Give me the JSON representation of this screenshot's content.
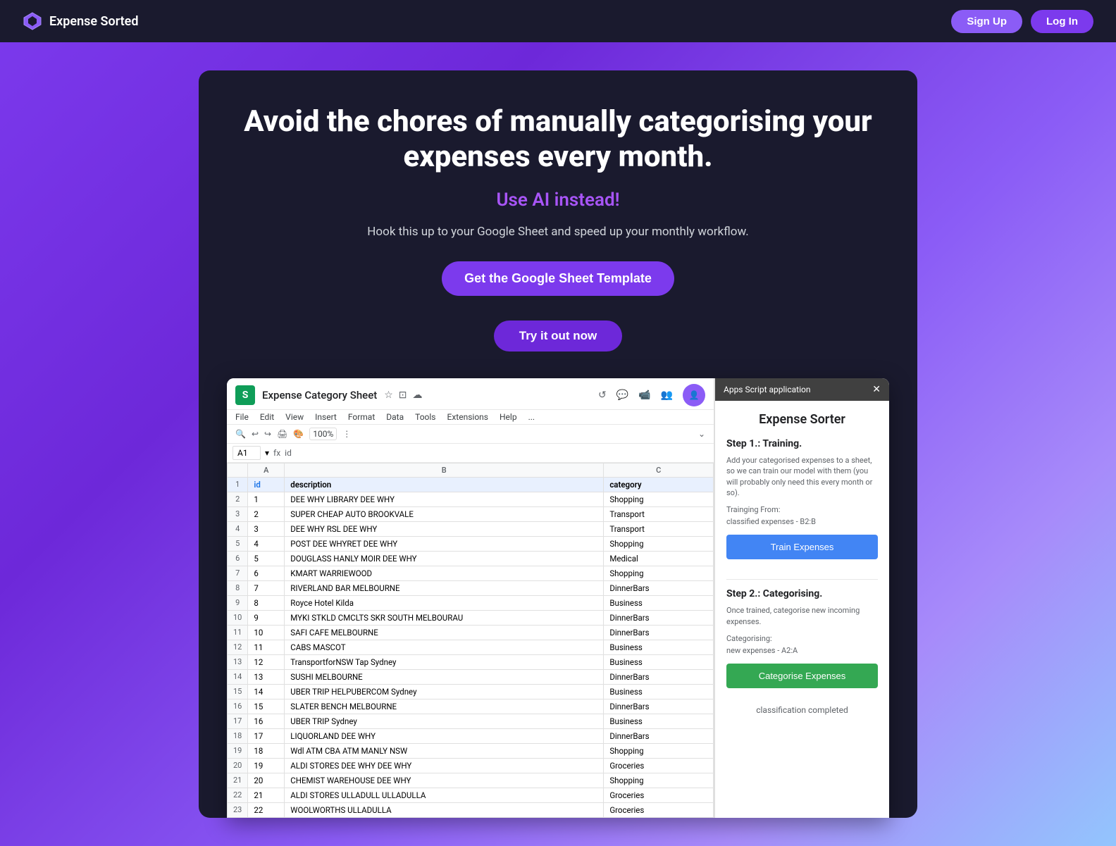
{
  "nav": {
    "brand": "Expense Sorted",
    "signup_label": "Sign Up",
    "login_label": "Log In"
  },
  "hero": {
    "headline": "Avoid the chores of manually categorising your expenses every month.",
    "subheadline": "Use AI instead!",
    "description": "Hook this up to your Google Sheet and speed up your monthly workflow.",
    "btn_google_sheet": "Get the Google Sheet Template",
    "btn_try": "Try it out now"
  },
  "spreadsheet": {
    "title": "Expense Category Sheet",
    "cell_ref": "A1",
    "cell_formula": "id",
    "menu_items": [
      "File",
      "Edit",
      "View",
      "Insert",
      "Format",
      "Data",
      "Tools",
      "Extensions",
      "Help",
      "..."
    ],
    "zoom": "100%",
    "columns": [
      "",
      "A",
      "B",
      "C"
    ],
    "header": [
      "",
      "id",
      "description",
      "category"
    ],
    "rows": [
      [
        "2",
        "1",
        "DEE WHY LIBRARY DEE WHY",
        "Shopping"
      ],
      [
        "3",
        "2",
        "SUPER CHEAP AUTO BROOKVALE",
        "Transport"
      ],
      [
        "4",
        "3",
        "DEE WHY RSL DEE WHY",
        "Transport"
      ],
      [
        "5",
        "4",
        "POST DEE WHYRET DEE WHY",
        "Shopping"
      ],
      [
        "6",
        "5",
        "DOUGLASS HANLY MOIR DEE WHY",
        "Medical"
      ],
      [
        "7",
        "6",
        "KMART WARRIEWOOD",
        "Shopping"
      ],
      [
        "8",
        "7",
        "RIVERLAND BAR MELBOURNE",
        "DinnerBars"
      ],
      [
        "9",
        "8",
        "Royce Hotel Kilda",
        "Business"
      ],
      [
        "10",
        "9",
        "MYKI STKLD CMCLTS SKR SOUTH MELBOURAU",
        "DinnerBars"
      ],
      [
        "11",
        "10",
        "SAFI CAFE MELBOURNE",
        "DinnerBars"
      ],
      [
        "12",
        "11",
        "CABS MASCOT",
        "Business"
      ],
      [
        "13",
        "12",
        "TransportforNSW Tap Sydney",
        "Business"
      ],
      [
        "14",
        "13",
        "SUSHI MELBOURNE",
        "DinnerBars"
      ],
      [
        "15",
        "14",
        "UBER TRIP HELPUBERCOM Sydney",
        "Business"
      ],
      [
        "16",
        "15",
        "SLATER BENCH MELBOURNE",
        "DinnerBars"
      ],
      [
        "17",
        "16",
        "UBER TRIP Sydney",
        "Business"
      ],
      [
        "18",
        "17",
        "LIQUORLAND DEE WHY",
        "DinnerBars"
      ],
      [
        "19",
        "18",
        "Wdl ATM CBA ATM MANLY NSW",
        "Shopping"
      ],
      [
        "20",
        "19",
        "ALDI STORES DEE WHY DEE WHY",
        "Groceries"
      ],
      [
        "21",
        "20",
        "CHEMIST WAREHOUSE DEE WHY",
        "Shopping"
      ],
      [
        "22",
        "21",
        "ALDI STORES ULLADULL ULLADULLA",
        "Groceries"
      ],
      [
        "23",
        "22",
        "WOOLWORTHS ULLADULLA",
        "Groceries"
      ]
    ]
  },
  "apps_script": {
    "panel_title": "Apps Script application",
    "app_title": "Expense Sorter",
    "step1_title": "Step 1.: Training.",
    "step1_desc": "Add your categorised expenses to a sheet, so we can train our model with them (you will probably only need this every month or so).",
    "training_from_label": "Trainging From:",
    "training_from_value": "classified expenses - B2:B",
    "train_btn": "Train Expenses",
    "step2_title": "Step 2.: Categorising.",
    "step2_desc": "Once trained, categorise new incoming expenses.",
    "categorising_label": "Categorising:",
    "categorising_value": "new expenses - A2:A",
    "categorise_btn": "Categorise Expenses",
    "completed_text": "classification completed"
  }
}
